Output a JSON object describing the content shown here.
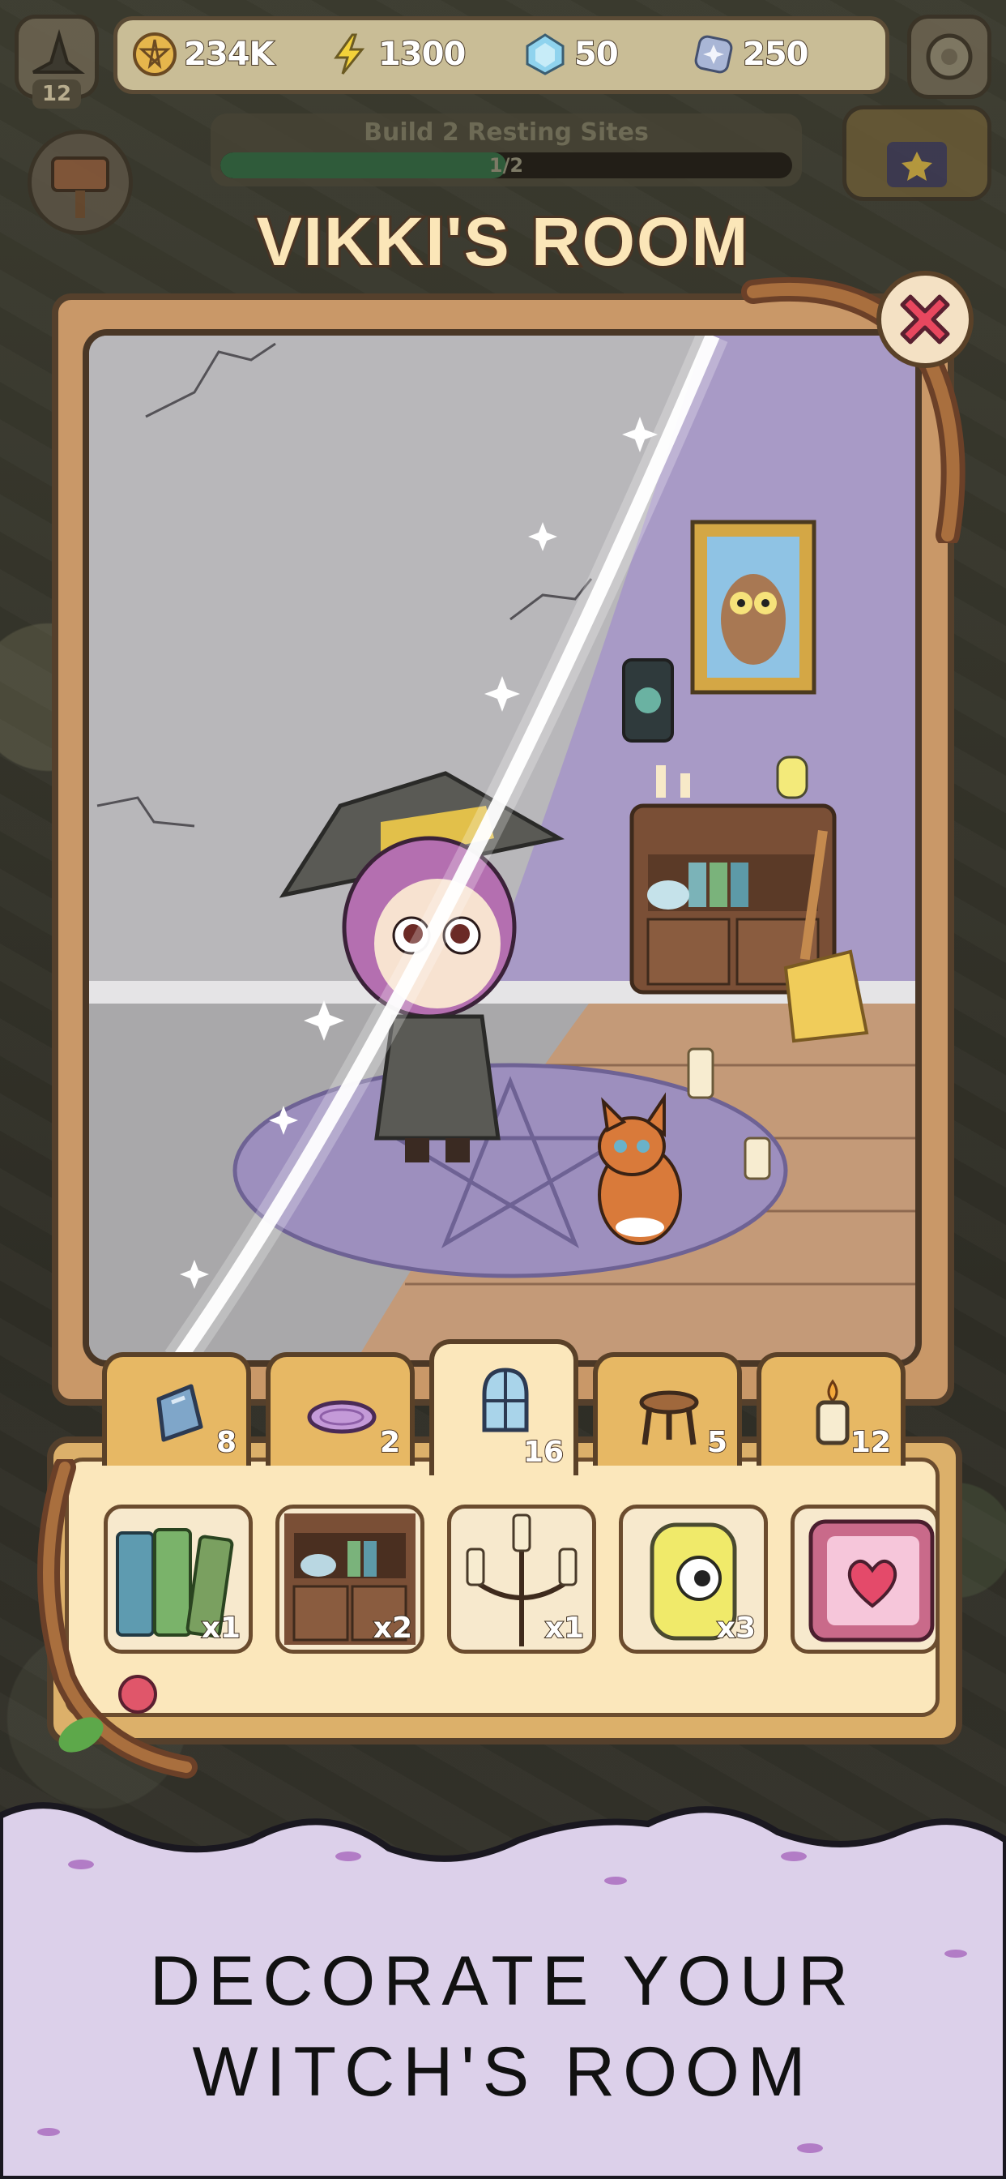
{
  "resources": {
    "coins": "234K",
    "energy": "1300",
    "crystals": "50",
    "stones": "250"
  },
  "player": {
    "level": "12"
  },
  "quest": {
    "title": "Build 2 Resting Sites",
    "progress_text": "1/2",
    "progress": 0.5
  },
  "room": {
    "title": "VIKKI'S ROOM"
  },
  "tabs": [
    {
      "icon": "mirror-icon",
      "count": "8",
      "active": false
    },
    {
      "icon": "rug-icon",
      "count": "2",
      "active": false
    },
    {
      "icon": "window-icon",
      "count": "16",
      "active": true
    },
    {
      "icon": "stool-icon",
      "count": "5",
      "active": false
    },
    {
      "icon": "candle-icon",
      "count": "12",
      "active": false
    }
  ],
  "items": [
    {
      "icon": "books-icon",
      "qty": "x1"
    },
    {
      "icon": "cabinet-icon",
      "qty": "x2"
    },
    {
      "icon": "candelabra-icon",
      "qty": "x1"
    },
    {
      "icon": "eye-jar-icon",
      "qty": "x3"
    },
    {
      "icon": "heart-card-icon",
      "qty": ""
    }
  ],
  "banner": {
    "line1": "DECORATE YOUR",
    "line2": "WITCH'S ROOM"
  },
  "colors": {
    "frame": "#c99868",
    "outline": "#55402c",
    "panel": "#fbe7bb",
    "tab": "#e7b864",
    "close": "#e8475f",
    "banner": "#dcd0ea"
  }
}
